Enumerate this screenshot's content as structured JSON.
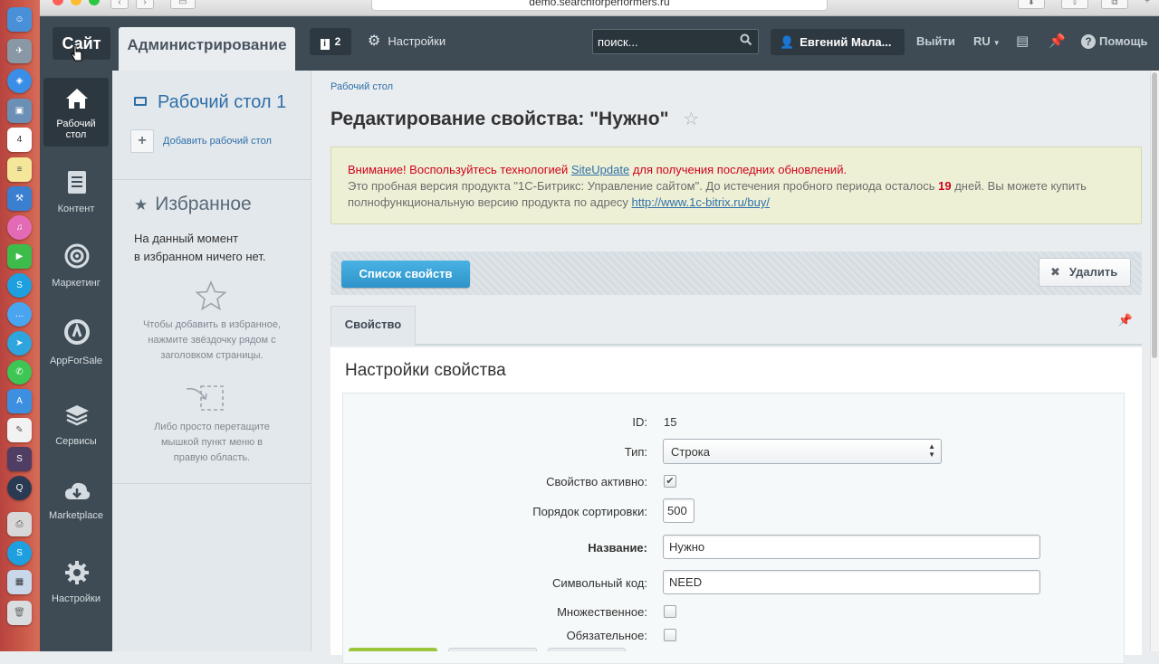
{
  "browser": {
    "url": "demo.searchforperformers.ru"
  },
  "top_panel": {
    "site_tab": "Сайт",
    "admin_tab": "Администрирование",
    "notifications_count": "2",
    "settings_label": "Настройки",
    "search_placeholder": "поиск...",
    "user_name": "Евгений Мала...",
    "logout_label": "Выйти",
    "language": "RU",
    "help_label": "Помощь"
  },
  "left_menu": {
    "items": [
      {
        "label": "Рабочий стол",
        "icon": "home-icon",
        "active": true
      },
      {
        "label": "Контент",
        "icon": "document-icon"
      },
      {
        "label": "Маркетинг",
        "icon": "target-icon"
      },
      {
        "label": "AppForSale",
        "icon": "appforsale-icon"
      },
      {
        "label": "Сервисы",
        "icon": "layers-icon"
      },
      {
        "label": "Marketplace",
        "icon": "cloud-download-icon"
      },
      {
        "label": "Настройки",
        "icon": "gear-icon"
      }
    ]
  },
  "favorites_panel": {
    "desktop_title": "Рабочий стол 1",
    "add_desktop": "Добавить рабочий стол",
    "favorites_title": "Избранное",
    "empty_text_1": "На данный момент",
    "empty_text_2": "в избранном ничего нет.",
    "hint_star_1": "Чтобы добавить в избранное,",
    "hint_star_2": "нажмите звёздочку рядом с",
    "hint_star_3": "заголовком страницы.",
    "hint_drag_1": "Либо просто перетащите",
    "hint_drag_2": "мышкой пункт меню в",
    "hint_drag_3": "правую область."
  },
  "main": {
    "breadcrumb": "Рабочий стол",
    "title": "Редактирование свойства: \"Нужно\"",
    "alert": {
      "line1_before": "Внимание! Воспользуйтесь технологией ",
      "line1_link": "SiteUpdate",
      "line1_after": " для получения последних обновлений.",
      "line2_before": "Это пробная версия продукта \"1С-Битрикс: Управление сайтом\". До истечения пробного периода осталось ",
      "line2_days": "19",
      "line2_after": " дней. Вы можете купить",
      "line3_before": "полнофункциональную версию продукта по адресу ",
      "line3_link": "http://www.1c-bitrix.ru/buy/"
    },
    "list_button": "Список свойств",
    "delete_button": "Удалить",
    "tab_label": "Свойство",
    "form_title": "Настройки свойства",
    "fields": {
      "id_label": "ID:",
      "id_value": "15",
      "type_label": "Тип:",
      "type_value": "Строка",
      "active_label": "Свойство активно:",
      "active_checked": true,
      "sort_label": "Порядок сортировки:",
      "sort_value": "500",
      "name_label": "Название:",
      "name_value": "Нужно",
      "code_label": "Символьный код:",
      "code_value": "NEED",
      "multiple_label": "Множественное:",
      "required_label": "Обязательное:"
    }
  },
  "colors": {
    "panel_dark": "#3f4b54",
    "accent_blue": "#2e93c9",
    "alert_red": "#d0021b",
    "link": "#2f6fa8"
  }
}
